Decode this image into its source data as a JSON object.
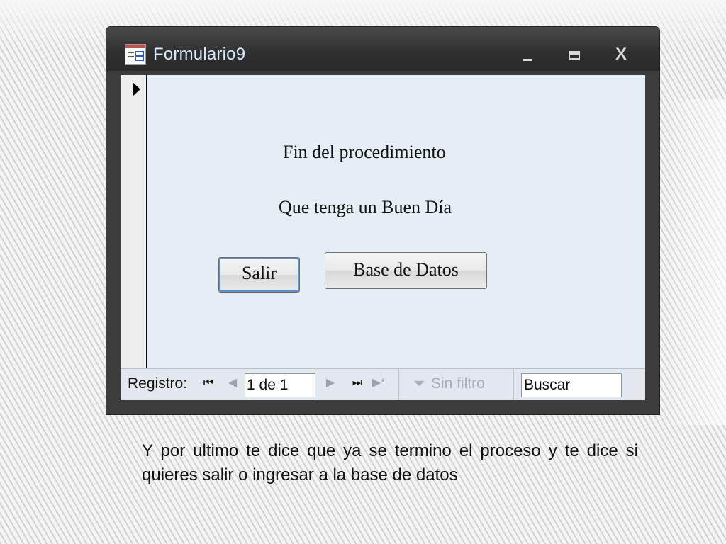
{
  "window": {
    "title": "Formulario9",
    "controls": {
      "minimize": "_",
      "maximize": "□",
      "close": "X"
    }
  },
  "form": {
    "message_line1": "Fin del procedimiento",
    "message_line2": "Que tenga un Buen Día",
    "exit_button": "Salir",
    "database_button": "Base de Datos"
  },
  "navigation": {
    "label": "Registro:",
    "record_position": "1 de 1",
    "filter_label": "Sin filtro",
    "search_placeholder": "Buscar",
    "icons": {
      "first": "first-record-icon",
      "prev": "previous-record-icon",
      "next": "next-record-icon",
      "last": "last-record-icon",
      "new": "new-record-icon",
      "filter": "filter-icon"
    }
  },
  "slide": {
    "caption": "Y por ultimo te dice que ya se termino el proceso y te dice si quieres salir o ingresar a la base de datos"
  },
  "colors": {
    "window_frame": "#3c3c3c",
    "title_text": "#d7e7fb",
    "form_background": "#e5edf5",
    "focus_outline": "#5d8fc7"
  }
}
